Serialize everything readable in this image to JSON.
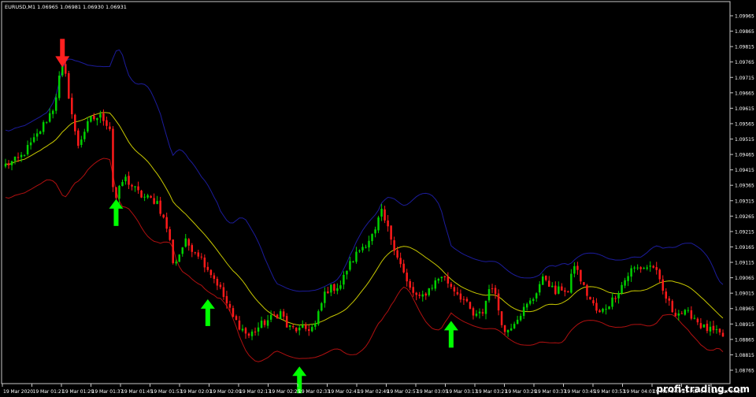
{
  "chart_header": "EURUSD,M1  1.06965 1.06981 1.06930 1.06931",
  "watermark": "profi-trading.com",
  "colors": {
    "background": "#000000",
    "frame": "#c8c8c8",
    "bull": "#00d100",
    "bear": "#ff1a1a",
    "band_upper": "#1c1c9c",
    "band_middle": "#c8c800",
    "band_lower": "#b01010",
    "arrow_up": "#00ff00",
    "arrow_down": "#ff2020",
    "text": "#ffffff"
  },
  "chart_data": {
    "type": "candlestick",
    "symbol": "EURUSD",
    "timeframe": "M1",
    "grid": false,
    "ylim": [
      1.08745,
      1.09995
    ],
    "y_ticks": [
      "1.09965",
      "1.09865",
      "1.09815",
      "1.09765",
      "1.09715",
      "1.09665",
      "1.09615",
      "1.09565",
      "1.09515",
      "1.09465",
      "1.09415",
      "1.09365",
      "1.09315",
      "1.09265",
      "1.09215",
      "1.09165",
      "1.09115",
      "1.09065",
      "1.09015",
      "1.08965",
      "1.08915",
      "1.08865",
      "1.08815",
      "1.08765"
    ],
    "x_ticks": [
      "19 Mar 2020",
      "19 Mar 01:21",
      "19 Mar 01:29",
      "19 Mar 01:37",
      "19 Mar 01:45",
      "19 Mar 01:53",
      "19 Mar 02:01",
      "19 Mar 02:09",
      "19 Mar 02:17",
      "19 Mar 02:25",
      "19 Mar 02:33",
      "19 Mar 02:41",
      "19 Mar 02:49",
      "19 Mar 02:57",
      "19 Mar 03:05",
      "19 Mar 03:13",
      "19 Mar 03:21",
      "19 Mar 03:29",
      "19 Mar 03:37",
      "19 Mar 03:45",
      "19 Mar 03:53",
      "19 Mar 04:01",
      "19 Mar 04:09",
      "19 Mar 04:17",
      "19 Mar 04:25"
    ],
    "candle_count": 228,
    "price_path": [
      [
        0,
        1.0946
      ],
      [
        10,
        1.0948
      ],
      [
        22,
        1.0955
      ],
      [
        35,
        1.0965
      ],
      [
        40,
        1.0977
      ],
      [
        42,
        1.0979
      ],
      [
        48,
        1.0963
      ],
      [
        52,
        1.0952
      ],
      [
        58,
        1.0958
      ],
      [
        62,
        1.0961
      ],
      [
        70,
        1.0962
      ],
      [
        76,
        1.0958
      ],
      [
        78,
        1.0938
      ],
      [
        80,
        1.0935
      ],
      [
        86,
        1.0942
      ],
      [
        90,
        1.094
      ],
      [
        98,
        1.0936
      ],
      [
        110,
        1.0934
      ],
      [
        118,
        1.0924
      ],
      [
        122,
        1.0913
      ],
      [
        130,
        1.0921
      ],
      [
        140,
        1.0917
      ],
      [
        154,
        1.0907
      ],
      [
        165,
        1.0896
      ],
      [
        176,
        1.089
      ],
      [
        186,
        1.0894
      ],
      [
        200,
        1.0898
      ],
      [
        204,
        1.0893
      ],
      [
        213,
        1.0892
      ],
      [
        224,
        1.0893
      ],
      [
        232,
        1.0905
      ],
      [
        244,
        1.0907
      ],
      [
        246,
        1.0911
      ],
      [
        256,
        1.0918
      ],
      [
        268,
        1.0924
      ],
      [
        272,
        1.0931
      ],
      [
        278,
        1.0924
      ],
      [
        286,
        1.0914
      ],
      [
        292,
        1.0906
      ],
      [
        300,
        1.0902
      ],
      [
        308,
        1.0906
      ],
      [
        316,
        1.091
      ],
      [
        322,
        1.0907
      ],
      [
        332,
        1.0902
      ],
      [
        340,
        1.0896
      ],
      [
        346,
        1.0898
      ],
      [
        352,
        1.0908
      ],
      [
        362,
        1.0891
      ],
      [
        372,
        1.0897
      ],
      [
        382,
        1.0902
      ],
      [
        388,
        1.0908
      ],
      [
        392,
        1.0909
      ],
      [
        398,
        1.0904
      ],
      [
        404,
        1.0906
      ],
      [
        408,
        1.0904
      ],
      [
        412,
        1.0914
      ],
      [
        420,
        1.0905
      ],
      [
        430,
        1.0897
      ],
      [
        440,
        1.0902
      ],
      [
        454,
        1.0912
      ],
      [
        470,
        1.0913
      ],
      [
        476,
        1.0905
      ],
      [
        484,
        1.0898
      ],
      [
        498,
        1.0897
      ],
      [
        505,
        1.0893
      ],
      [
        520,
        1.089
      ]
    ],
    "markers": [
      {
        "type": "sell",
        "candle": 42
      },
      {
        "type": "buy",
        "candle": 80
      },
      {
        "type": "buy",
        "candle": 146
      },
      {
        "type": "buy",
        "candle": 214
      },
      {
        "type": "buy",
        "candle": 322
      }
    ]
  }
}
